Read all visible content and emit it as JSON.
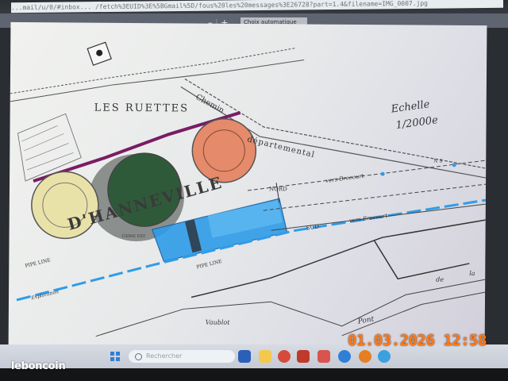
{
  "browser": {
    "url": "...mail/u/0/#inbox... /fetch%3EUID%3E%5BGmail%5D/fous%20les%20messages%3E26728?part=1.4&filename=IMG_0007.jpg",
    "zoom_minus": "–",
    "zoom_plus": "+",
    "zoom_select": "Choix automatique"
  },
  "plan": {
    "place_ruettes": "LES RUETTES",
    "road_chemin": "Chemin",
    "road_departemental": "départemental",
    "scale_word": "Echelle",
    "scale_value": "1/2000e",
    "label_nord": "NORD",
    "label_vers_brecourt_1": "vers Brecourt",
    "label_vers_brecourt_2": "vers Brecourt",
    "label_sud": "SUD",
    "site_name": "D'HANNEVILLE",
    "label_vaublot": "Vaublot",
    "label_pont": "Pont",
    "label_de": "de",
    "label_la": "la",
    "label_usine": "USINE EST",
    "label_pipe_line_1": "PIPE LINE",
    "label_pipe_line_2": "PIPE LINE",
    "label_exploration": "Exploration",
    "label_north_south": "N S"
  },
  "taskbar": {
    "search_placeholder": "Rechercher"
  },
  "overlay": {
    "watermark": "leboncoin",
    "timestamp": "01.03.2026 12:58"
  },
  "colors": {
    "tank_orange": "#e58a6a",
    "tank_yellow": "#e9e2a8",
    "tank_green": "#2f5a3a",
    "highlight_blue": "#2f9ce8",
    "stamp_orange": "#ff7a16",
    "road_purple": "#7a1c64"
  }
}
